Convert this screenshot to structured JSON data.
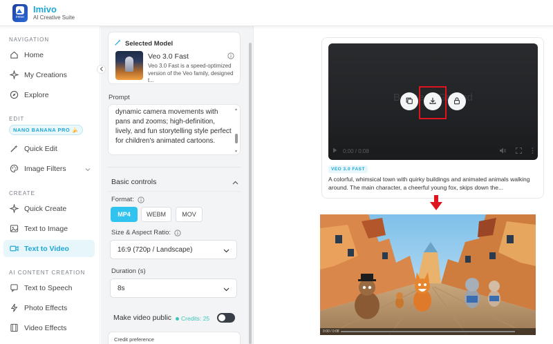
{
  "app": {
    "name": "Imivo",
    "subtitle": "AI Creative Suite",
    "logo_text": "imivo"
  },
  "sidebar": {
    "sections": {
      "navigation": "NAVIGATION",
      "edit": "EDIT",
      "create": "CREATE",
      "ai_content": "AI CONTENT CREATION"
    },
    "badge": "NANO BANANA PRO 🍌",
    "items": [
      {
        "label": "Home",
        "icon": "home-icon"
      },
      {
        "label": "My Creations",
        "icon": "sparkle-icon"
      },
      {
        "label": "Explore",
        "icon": "compass-icon"
      },
      {
        "label": "Quick Edit",
        "icon": "magic-wand-icon"
      },
      {
        "label": "Image Filters",
        "icon": "palette-icon"
      },
      {
        "label": "Quick Create",
        "icon": "sparkle-icon"
      },
      {
        "label": "Text to Image",
        "icon": "image-icon"
      },
      {
        "label": "Text to Video",
        "icon": "video-icon",
        "active": true
      },
      {
        "label": "Text to Speech",
        "icon": "speech-icon"
      },
      {
        "label": "Photo Effects",
        "icon": "bolt-icon"
      },
      {
        "label": "Video Effects",
        "icon": "film-icon"
      }
    ]
  },
  "panel": {
    "selected_model_heading": "Selected Model",
    "model_name": "Veo 3.0 Fast",
    "model_desc": "Veo 3.0 Fast is a speed-optimized version of the Veo family, designed t...",
    "prompt_label": "Prompt",
    "prompt_text": "dynamic camera movements with pans and zooms; high-definition, lively, and fun storytelling style perfect for children's animated cartoons.",
    "basic_controls": "Basic controls",
    "format_label": "Format:",
    "formats": [
      "MP4",
      "WEBM",
      "MOV"
    ],
    "selected_format": "MP4",
    "aspect_label": "Size & Aspect Ratio:",
    "aspect_value": "16:9 (720p / Landscape)",
    "duration_label": "Duration (s)",
    "duration_value": "8s",
    "public_label": "Make video public",
    "credits": "Credits: 25",
    "public_on": false,
    "credit_pref_label": "Credit preference"
  },
  "result": {
    "video_ghost_text": "Before ... Ground",
    "time": "0:00 / 0:08",
    "tag": "VEO 3.0 FAST",
    "description": "A colorful, whimsical town with quirky buildings and animated animals walking around. The main character, a cheerful young fox, skips down the...",
    "frame_time": "0:00 / 0:08"
  },
  "colors": {
    "accent": "#31c3ef",
    "brand": "#1ea7d6",
    "highlight": "#e0141e"
  }
}
